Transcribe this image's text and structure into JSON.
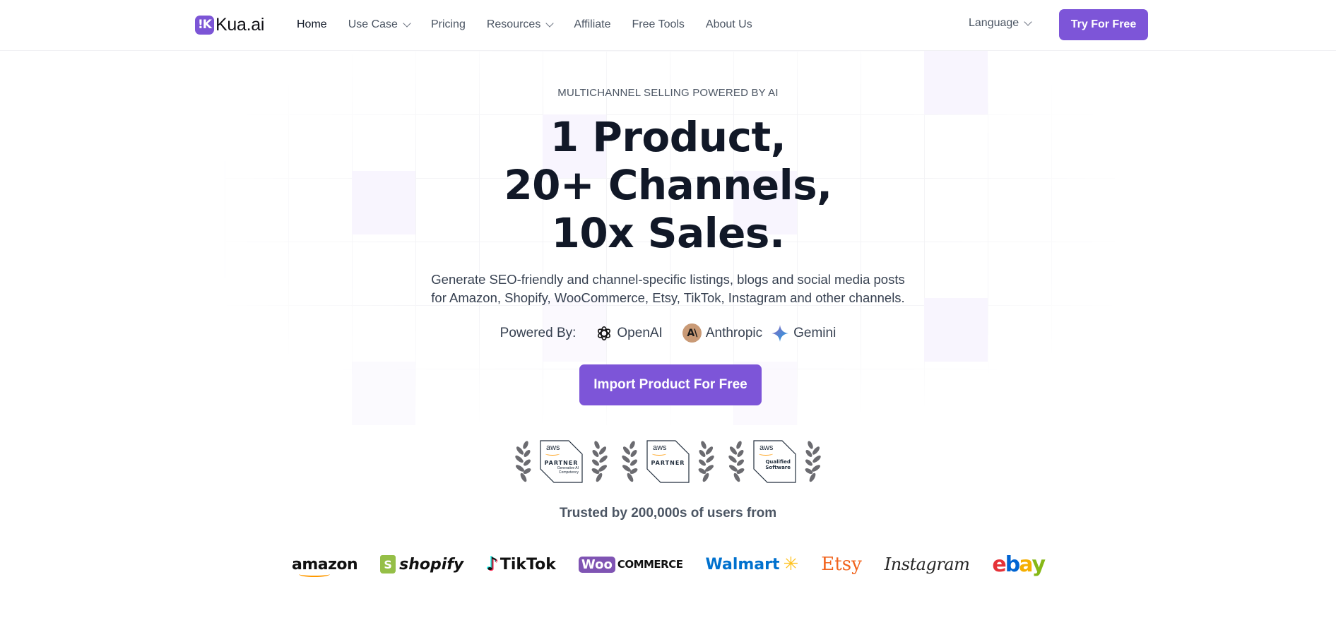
{
  "header": {
    "logo_mark": "!K",
    "logo_text": "Kua.ai",
    "nav": [
      {
        "label": "Home",
        "active": true,
        "dropdown": false
      },
      {
        "label": "Use Case",
        "active": false,
        "dropdown": true
      },
      {
        "label": "Pricing",
        "active": false,
        "dropdown": false
      },
      {
        "label": "Resources",
        "active": false,
        "dropdown": true
      },
      {
        "label": "Affiliate",
        "active": false,
        "dropdown": false
      },
      {
        "label": "Free Tools",
        "active": false,
        "dropdown": false
      },
      {
        "label": "About Us",
        "active": false,
        "dropdown": false
      }
    ],
    "language_label": "Language",
    "cta_label": "Try For Free"
  },
  "hero": {
    "eyebrow": "MULTICHANNEL SELLING POWERED BY AI",
    "headline_lines": [
      "1 Product,",
      "20+ Channels,",
      "10x Sales."
    ],
    "subtitle_lines": [
      "Generate SEO-friendly and channel-specific listings, blogs and social media posts",
      "for Amazon, Shopify, WooCommerce, Etsy, TikTok, Instagram and other channels."
    ],
    "powered_by_label": "Powered By:",
    "providers": [
      {
        "name": "OpenAI",
        "icon": "openai-icon"
      },
      {
        "name": "Anthropic",
        "icon": "anthropic-icon",
        "mark": "A\\"
      },
      {
        "name": "Gemini",
        "icon": "gemini-sparkle-icon"
      }
    ],
    "cta_label": "Import Product For Free"
  },
  "badges": [
    {
      "logo": "aws",
      "title": "PARTNER",
      "subtitle": [
        "Generative AI",
        "Competency"
      ]
    },
    {
      "logo": "aws",
      "title": "PARTNER",
      "subtitle": []
    },
    {
      "logo": "aws",
      "title": "",
      "subtitle": [
        "Qualified",
        "Software"
      ]
    }
  ],
  "trusted": {
    "label": "Trusted by 200,000s of users from",
    "brands": [
      {
        "name": "amazon"
      },
      {
        "name": "shopify",
        "mark": "S"
      },
      {
        "name": "TikTok"
      },
      {
        "name": "WooCommerce",
        "box": "Woo",
        "text": "COMMERCE"
      },
      {
        "name": "Walmart"
      },
      {
        "name": "Etsy"
      },
      {
        "name": "Instagram"
      },
      {
        "name": "ebay",
        "letters": [
          {
            "ch": "e",
            "color": "#e53238"
          },
          {
            "ch": "b",
            "color": "#0064d2"
          },
          {
            "ch": "a",
            "color": "#f5af02"
          },
          {
            "ch": "y",
            "color": "#86b817"
          }
        ]
      }
    ]
  },
  "colors": {
    "brand_purple": "#7d55d8",
    "headline": "#111827",
    "body_text": "#374151"
  }
}
